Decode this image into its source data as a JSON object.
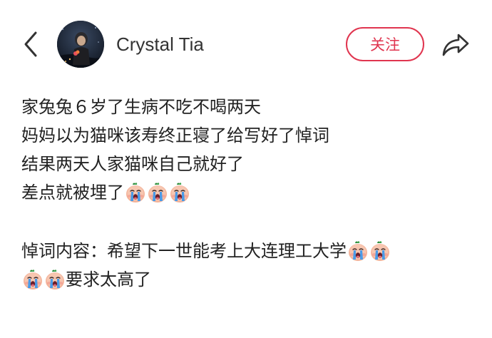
{
  "header": {
    "username": "Crystal Tia",
    "follow_label": "关注"
  },
  "icons": {
    "back": "back-chevron-icon",
    "share": "share-icon",
    "emoji": "crying-face-emoji-icon"
  },
  "colors": {
    "accent": "#e0354f",
    "text": "#222222"
  },
  "post": {
    "line1": "家兔兔６岁了生病不吃不喝两天",
    "line2": "妈妈以为猫咪该寿终正寝了给写好了悼词",
    "line3": "结果两天人家猫咪自己就好了",
    "line4": "差点就被埋了",
    "line5": "悼词内容：希望下一世能考上大连理工大学",
    "line6": "要求太高了"
  }
}
